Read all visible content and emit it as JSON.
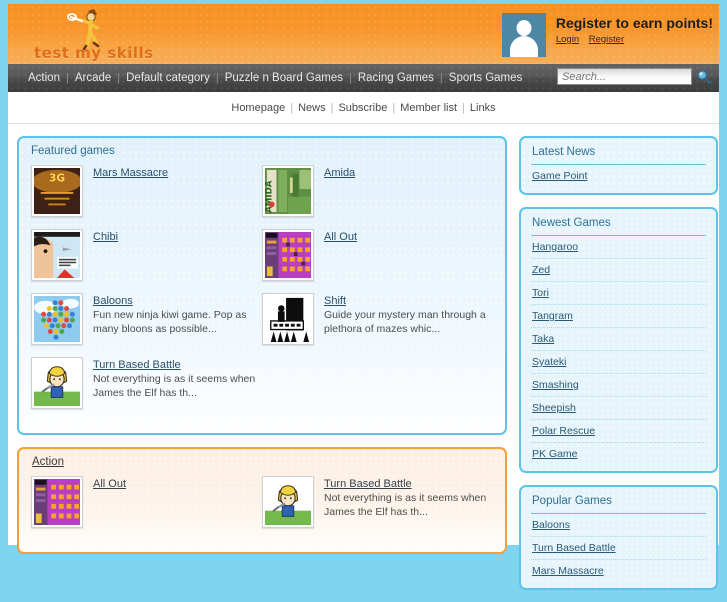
{
  "header": {
    "logo_text": "test my skills",
    "register_title": "Register to earn points!",
    "login_label": "Login",
    "register_label": "Register",
    "avatar_icon": "user-avatar-icon"
  },
  "nav": {
    "items": [
      {
        "label": "Action"
      },
      {
        "label": "Arcade"
      },
      {
        "label": "Default category"
      },
      {
        "label": "Puzzle n Board Games"
      },
      {
        "label": "Racing Games"
      },
      {
        "label": "Sports Games"
      }
    ],
    "search": {
      "placeholder": "Search...",
      "value": "",
      "icon": "search-magnifier-icon"
    }
  },
  "subnav": {
    "items": [
      {
        "label": "Homepage"
      },
      {
        "label": "News"
      },
      {
        "label": "Subscribe"
      },
      {
        "label": "Member list"
      },
      {
        "label": "Links"
      }
    ]
  },
  "featured": {
    "title": "Featured games",
    "games": [
      {
        "title": "Mars Massacre",
        "desc": "",
        "thumb": "mars-massacre-thumb"
      },
      {
        "title": "Amida",
        "desc": "",
        "thumb": "amida-thumb"
      },
      {
        "title": "Chibi",
        "desc": "",
        "thumb": "chibi-thumb"
      },
      {
        "title": "All Out",
        "desc": "",
        "thumb": "all-out-thumb"
      },
      {
        "title": "Baloons",
        "desc": "Fun new ninja kiwi game. Pop as many bloons as possible...",
        "thumb": "baloons-thumb"
      },
      {
        "title": "Shift",
        "desc": "Guide your mystery man through a plethora of mazes whic...",
        "thumb": "shift-thumb"
      },
      {
        "title": "Turn Based Battle",
        "desc": "Not everything is as it seems when James the Elf has th...",
        "thumb": "turn-based-battle-thumb"
      }
    ]
  },
  "action": {
    "title": "Action",
    "games": [
      {
        "title": "All Out",
        "desc": "",
        "thumb": "all-out-thumb"
      },
      {
        "title": "Turn Based Battle",
        "desc": "Not everything is as it seems when James the Elf has th...",
        "thumb": "turn-based-battle-thumb"
      }
    ]
  },
  "sidebar": {
    "latest_news": {
      "title": "Latest News",
      "items": [
        {
          "label": "Game Point"
        }
      ]
    },
    "newest_games": {
      "title": "Newest Games",
      "items": [
        {
          "label": "Hangaroo"
        },
        {
          "label": "Zed"
        },
        {
          "label": "Tori"
        },
        {
          "label": "Tangram"
        },
        {
          "label": "Taka"
        },
        {
          "label": "Syateki"
        },
        {
          "label": "Smashing"
        },
        {
          "label": "Sheepish"
        },
        {
          "label": "Polar Rescue"
        },
        {
          "label": "PK Game"
        }
      ]
    },
    "popular_games": {
      "title": "Popular Games",
      "items": [
        {
          "label": "Baloons"
        },
        {
          "label": "Turn Based Battle"
        },
        {
          "label": "Mars Massacre"
        }
      ]
    }
  },
  "colors": {
    "header_orange": "#f79122",
    "nav_dark": "#4a4a4a",
    "panel_blue": "#5cc4e8",
    "panel_orange": "#f79f34",
    "page_bg": "#7fd4ef",
    "link_blue": "#26506b"
  }
}
